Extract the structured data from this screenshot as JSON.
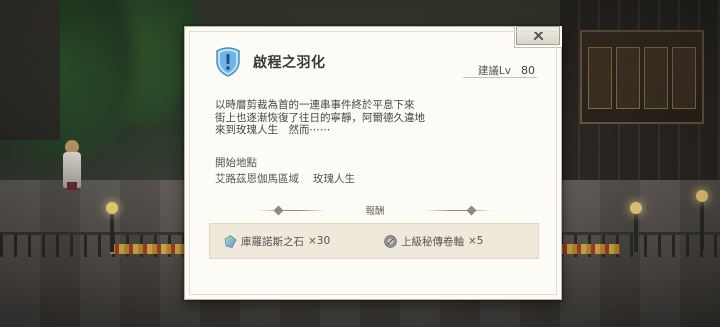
{
  "quest": {
    "title": "啟程之羽化",
    "level_label": "建議Lv",
    "level_value": "80",
    "description": "以時層剪裁為首的一連串事件終於平息下來\n街上也逐漸恢復了往日的寧靜，阿爾德久違地\n來到玫瑰人生　然而⋯⋯",
    "start_label": "開始地點",
    "start_area": "艾路茲恩伽馬區域",
    "start_place": "玫瑰人生",
    "reward_label": "報酬",
    "rewards": [
      {
        "name": "庫羅諾斯之石",
        "qty": "×30",
        "icon": "chronos-stone-icon"
      },
      {
        "name": "上級秘傳卷軸",
        "qty": "×5",
        "icon": "secret-scroll-icon"
      }
    ]
  },
  "colors": {
    "dialog_bg": "#fdfbf5",
    "reward_bg": "#efe9db",
    "icon_blue": "#6fb4e6"
  }
}
